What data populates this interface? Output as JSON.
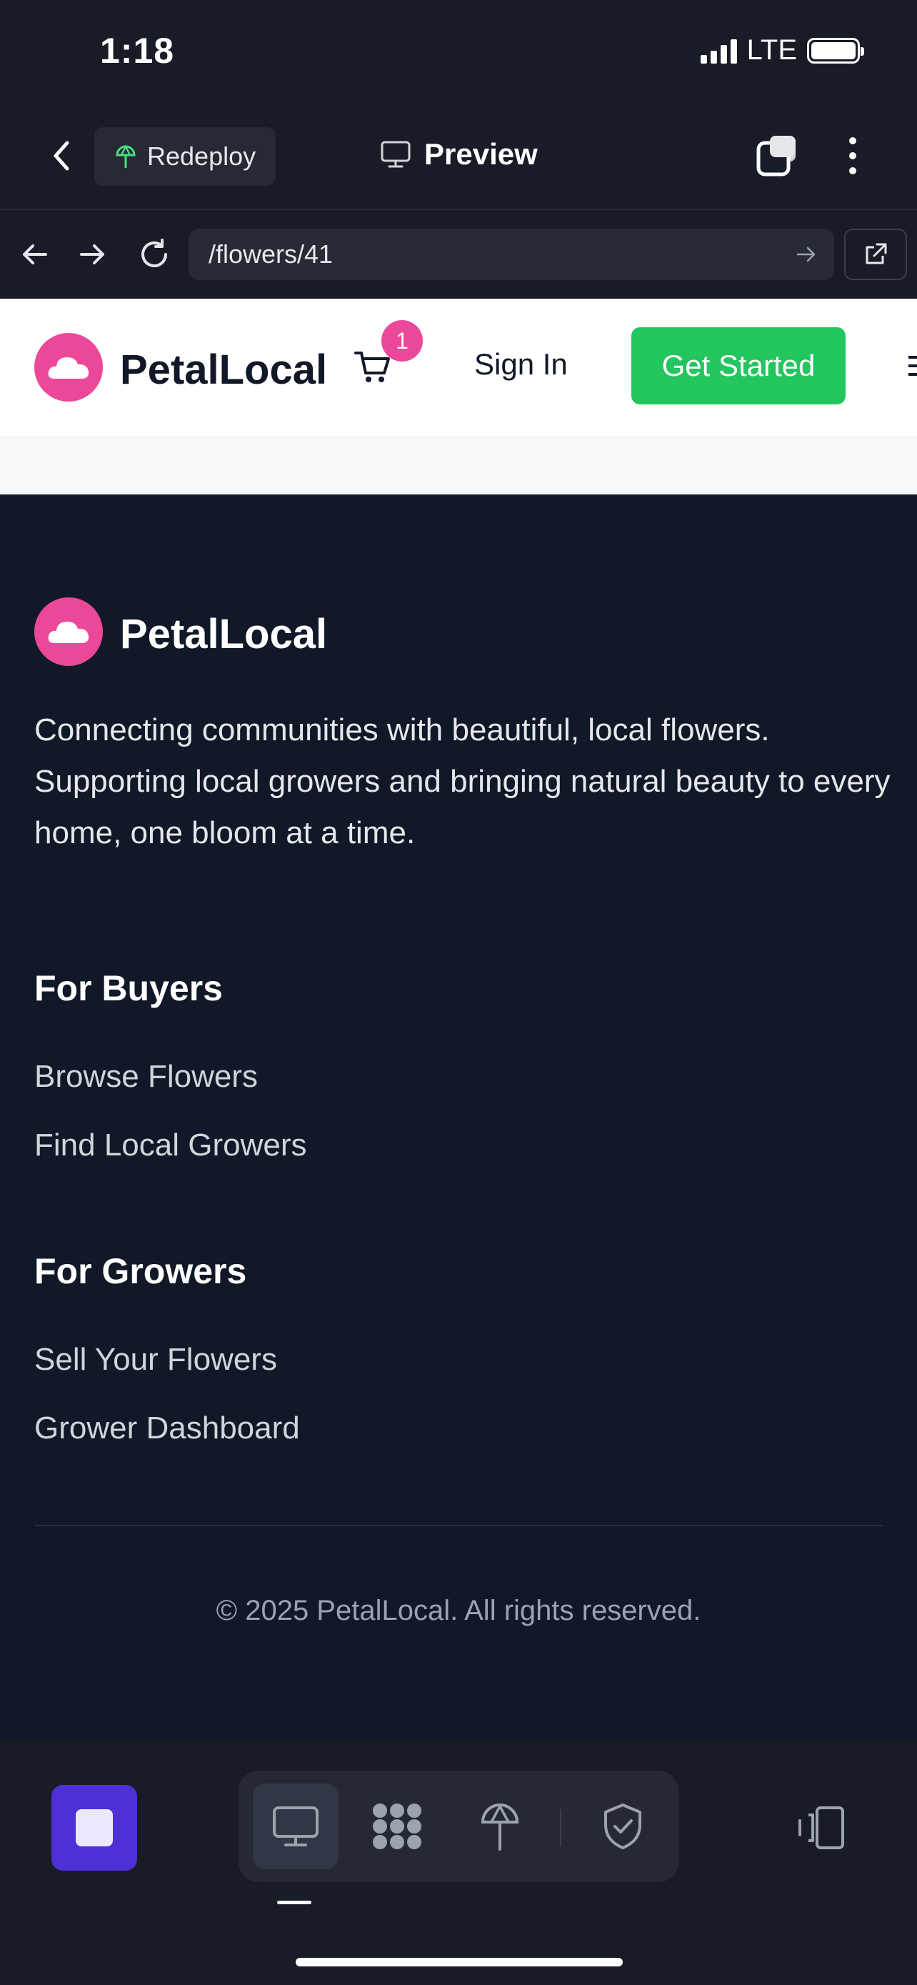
{
  "status_bar": {
    "time": "1:18",
    "network": "LTE"
  },
  "top_bar": {
    "back_icon": "chevron-left-icon",
    "redeploy_label": "Redeploy",
    "preview_label": "Preview",
    "tabs_icon": "tabs-icon",
    "more_icon": "more-vertical-icon"
  },
  "url_bar": {
    "url": "/flowers/41"
  },
  "site_header": {
    "brand": "PetalLocal",
    "cart_count": "1",
    "sign_in": "Sign In",
    "get_started": "Get Started",
    "brand_color": "#ec4899",
    "cta_color": "#22c55e"
  },
  "footer": {
    "brand": "PetalLocal",
    "description": "Connecting communities with beautiful, local flowers. Supporting local growers and bringing natural beauty to every home, one bloom at a time.",
    "buyers": {
      "heading": "For Buyers",
      "links": [
        "Browse Flowers",
        "Find Local Growers"
      ]
    },
    "growers": {
      "heading": "For Growers",
      "links": [
        "Sell Your Flowers",
        "Grower Dashboard"
      ]
    },
    "copyright": "© 2025 PetalLocal. All rights reserved."
  },
  "bottom_bar": {
    "stop_icon": "stop-icon",
    "tools": [
      "desktop-icon",
      "apps-icon",
      "deploy-icon",
      "shield-check-icon"
    ],
    "device_icon": "device-switch-icon",
    "stop_color": "#4f2fd6"
  }
}
